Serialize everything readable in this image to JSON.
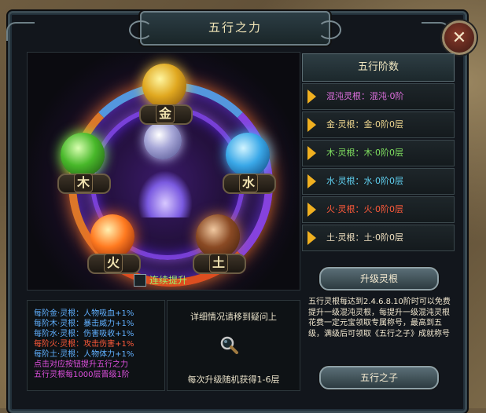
{
  "window": {
    "title": "五行之力",
    "close_icon": "close-x-icon"
  },
  "elements_art": {
    "orbs": [
      {
        "name": "gold",
        "symbol": "金",
        "color": "#e0a820"
      },
      {
        "name": "wood",
        "symbol": "木",
        "color": "#48b82a"
      },
      {
        "name": "water",
        "symbol": "水",
        "color": "#3aa8e8"
      },
      {
        "name": "fire",
        "symbol": "火",
        "color": "#ff7a20"
      },
      {
        "name": "earth",
        "symbol": "土",
        "color": "#8a4a24"
      }
    ],
    "auto_upgrade_label": "连续提升"
  },
  "rank_panel": {
    "header": "五行阶数",
    "rows": [
      {
        "text": "混沌灵根：混沌·0阶",
        "color": "#e070e0"
      },
      {
        "text": "金·灵根：金·0阶0层",
        "color": "#f0d890"
      },
      {
        "text": "木·灵根：木·0阶0层",
        "color": "#80e060"
      },
      {
        "text": "水·灵根：水·0阶0层",
        "color": "#60d0f0"
      },
      {
        "text": "火·灵根：火·0阶0层",
        "color": "#ff5a3a"
      },
      {
        "text": "土·灵根：土·0阶0层",
        "color": "#f0e0c0"
      }
    ]
  },
  "buttons": {
    "upgrade": "升级灵根",
    "wuxing_son": "五行之子"
  },
  "description": "五行灵根每达到2.4.6.8.10阶时可以免费提升一级混沌灵根，每提升一级混沌灵根花费一定元宝领取专属称号，最高到五级，满级后可领取《五行之子》成就称号",
  "bonus_list": [
    {
      "text": "每阶金·灵根：人物吸血+1%",
      "color": "#60b0ff"
    },
    {
      "text": "每阶木·灵根：暴击威力+1%",
      "color": "#60b0ff"
    },
    {
      "text": "每阶水·灵根：伤害吸收+1%",
      "color": "#60b0ff"
    },
    {
      "text": "每阶火·灵根：攻击伤害+1%",
      "color": "#ff5a3a"
    },
    {
      "text": "每阶土·灵根：人物体力+1%",
      "color": "#60b0ff"
    },
    {
      "text": "点击对应按钮提升五行之力",
      "color": "#e050e0"
    },
    {
      "text": "五行灵根每1000层晋级1阶",
      "color": "#e050e0"
    }
  ],
  "info": {
    "top": "详细情况请移到疑问上",
    "bottom": "每次升级随机获得1-6层",
    "icon": "magnifier-icon"
  }
}
